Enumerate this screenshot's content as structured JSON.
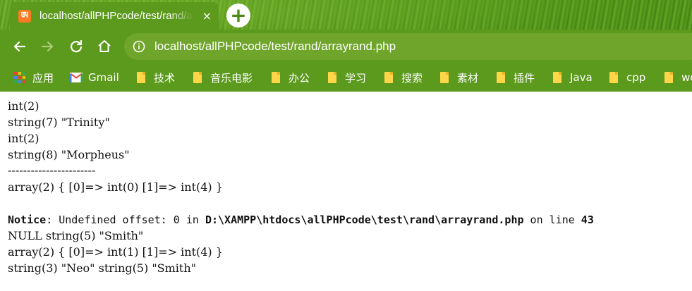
{
  "tab": {
    "favicon": "xampp-icon",
    "title": "localhost/allPHPcode/test/rand/arrayrand.php",
    "close": "×"
  },
  "newtab": "+",
  "toolbar": {
    "back": "back-icon",
    "forward": "forward-icon",
    "reload": "reload-icon",
    "home": "home-icon",
    "url": "localhost/allPHPcode/test/rand/arrayrand.php"
  },
  "bookmarks": [
    {
      "label": "应用",
      "icon": "apps-icon"
    },
    {
      "label": "Gmail",
      "icon": "gmail-icon"
    },
    {
      "label": "技术",
      "icon": "folder-icon"
    },
    {
      "label": "音乐电影",
      "icon": "folder-icon"
    },
    {
      "label": "办公",
      "icon": "folder-icon"
    },
    {
      "label": "学习",
      "icon": "folder-icon"
    },
    {
      "label": "搜索",
      "icon": "folder-icon"
    },
    {
      "label": "素材",
      "icon": "folder-icon"
    },
    {
      "label": "插件",
      "icon": "folder-icon"
    },
    {
      "label": "Java",
      "icon": "folder-icon"
    },
    {
      "label": "cpp",
      "icon": "folder-icon"
    },
    {
      "label": "wo",
      "icon": "folder-icon"
    }
  ],
  "output": {
    "lines": [
      "int(2)",
      "string(7) \"Trinity\"",
      "int(2)",
      "string(8) \"Morpheus\"",
      "-----------------------",
      "array(2) { [0]=> int(0) [1]=> int(4) }",
      "",
      "",
      "NULL string(5) \"Smith\"",
      "array(2) { [0]=> int(1) [1]=> int(4) }",
      "string(3) \"Neo\" string(5) \"Smith\""
    ],
    "notice": {
      "label": "Notice",
      "message": ": Undefined offset: 0 in ",
      "file": "D:\\XAMPP\\htdocs\\allPHPcode\\test\\rand\\arrayrand.php",
      "on_line": " on line ",
      "line_no": "43"
    }
  },
  "colors": {
    "theme_green": "#5b9a1c",
    "folder_yellow": "#ffd64a",
    "xampp_orange": "#fb7a24"
  }
}
